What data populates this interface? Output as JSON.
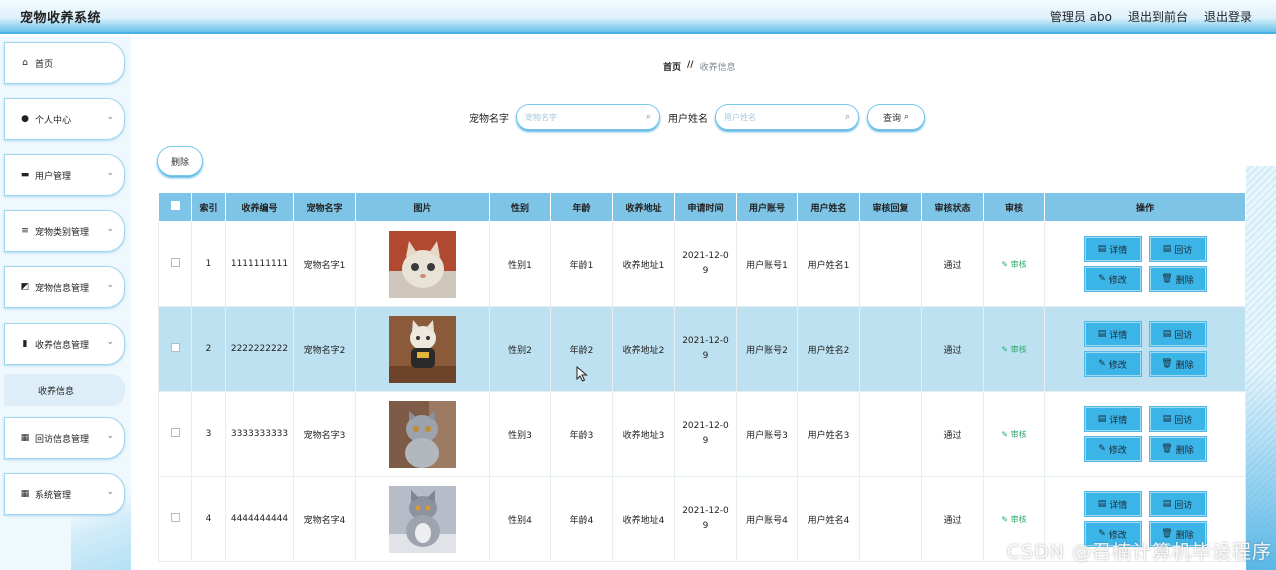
{
  "header": {
    "app_title": "宠物收养系统",
    "admin_label": "管理员 abo",
    "front_label": "退出到前台",
    "logout_label": "退出登录"
  },
  "sidebar": {
    "items": [
      {
        "label": "首页",
        "icon": "home-icon",
        "glyph": "⌂"
      },
      {
        "label": "个人中心",
        "icon": "user-icon",
        "glyph": "●"
      },
      {
        "label": "用户管理",
        "icon": "briefcase-icon",
        "glyph": "▬"
      },
      {
        "label": "宠物类别管理",
        "icon": "sliders-icon",
        "glyph": "≡"
      },
      {
        "label": "宠物信息管理",
        "icon": "chart-icon",
        "glyph": "◩"
      },
      {
        "label": "收养信息管理",
        "icon": "bar-chart-icon",
        "glyph": "▮"
      },
      {
        "label": "回访信息管理",
        "icon": "grid-icon",
        "glyph": "▦"
      },
      {
        "label": "系统管理",
        "icon": "grid-icon",
        "glyph": "▦"
      }
    ],
    "submenu_label": "收养信息"
  },
  "breadcrumb": {
    "home": "首页",
    "sep": "//",
    "current": "收养信息"
  },
  "search": {
    "pet_label": "宠物名字",
    "pet_placeholder": "宠物名字",
    "user_label": "用户姓名",
    "user_placeholder": "用户姓名",
    "query_label": "查询"
  },
  "actions": {
    "delete_label": "删除"
  },
  "table": {
    "headers": [
      "索引",
      "收养编号",
      "宠物名字",
      "图片",
      "性别",
      "年龄",
      "收养地址",
      "申请时间",
      "用户账号",
      "用户姓名",
      "审核回复",
      "审核状态",
      "审核",
      "操作"
    ],
    "op_labels": {
      "detail": "详情",
      "visit": "回访",
      "edit": "修改",
      "delete": "删除"
    },
    "rows": [
      {
        "idx": "1",
        "no": "1111111111",
        "pet": "宠物名字1",
        "sex": "性别1",
        "age": "年龄1",
        "addr": "收养地址1",
        "time": "2021-12-09",
        "account": "用户账号1",
        "name": "用户姓名1",
        "reply": "",
        "status": "通过",
        "audit": "审核"
      },
      {
        "idx": "2",
        "no": "2222222222",
        "pet": "宠物名字2",
        "sex": "性别2",
        "age": "年龄2",
        "addr": "收养地址2",
        "time": "2021-12-09",
        "account": "用户账号2",
        "name": "用户姓名2",
        "reply": "",
        "status": "通过",
        "audit": "审核"
      },
      {
        "idx": "3",
        "no": "3333333333",
        "pet": "宠物名字3",
        "sex": "性别3",
        "age": "年龄3",
        "addr": "收养地址3",
        "time": "2021-12-09",
        "account": "用户账号3",
        "name": "用户姓名3",
        "reply": "",
        "status": "通过",
        "audit": "审核"
      },
      {
        "idx": "4",
        "no": "4444444444",
        "pet": "宠物名字4",
        "sex": "性别4",
        "age": "年龄4",
        "addr": "收养地址4",
        "time": "2021-12-09",
        "account": "用户账号4",
        "name": "用户姓名4",
        "reply": "",
        "status": "通过",
        "audit": "审核"
      }
    ]
  },
  "watermark": "CSDN @召楠计算机毕设程序",
  "colors": {
    "accent": "#3bb4e8",
    "header_bg": "#7ec4e6",
    "row_highlight": "#bde1f1",
    "audit_green": "#2ea86b"
  }
}
